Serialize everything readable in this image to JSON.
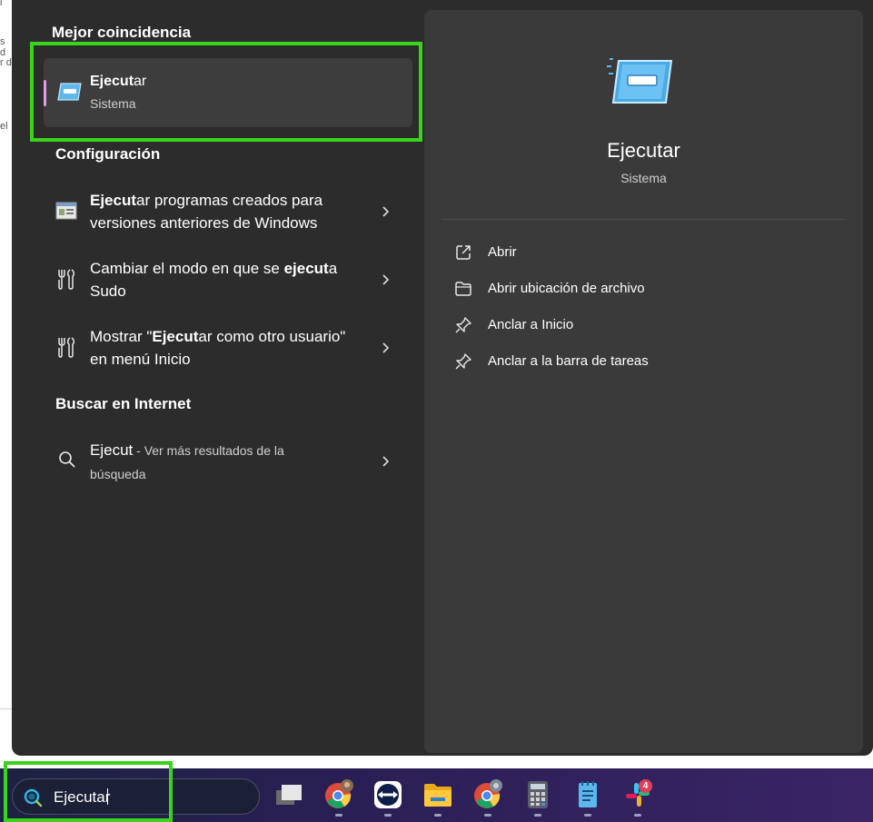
{
  "background": {
    "fragments": [
      "l",
      "s d",
      "r d",
      "el"
    ]
  },
  "search_panel": {
    "best_match": {
      "heading": "Mejor coincidencia",
      "title_bold": "Ejecut",
      "title_rest": "ar",
      "subtitle": "Sistema",
      "icon": "run-dialog-icon"
    },
    "settings": {
      "heading": "Configuración",
      "items": [
        {
          "icon": "compatibility-settings-icon",
          "pre": "",
          "bold": "Ejecut",
          "post": "ar programas creados para versiones anteriores de Windows"
        },
        {
          "icon": "developer-settings-icon",
          "pre": "Cambiar el modo en que se ",
          "bold": "ejecut",
          "post": "a Sudo"
        },
        {
          "icon": "developer-settings-icon",
          "pre": "Mostrar \"",
          "bold": "Ejecut",
          "post": "ar como otro usuario\" en menú Inicio"
        }
      ]
    },
    "web": {
      "heading": "Buscar en Internet",
      "query": "Ejecut",
      "suffix": " - Ver más resultados de la búsqueda",
      "icon": "search-icon"
    }
  },
  "details_pane": {
    "icon": "run-dialog-icon",
    "title": "Ejecutar",
    "subtitle": "Sistema",
    "actions": [
      {
        "label": "Abrir",
        "icon": "open-external-icon"
      },
      {
        "label": "Abrir ubicación de archivo",
        "icon": "folder-icon"
      },
      {
        "label": "Anclar a Inicio",
        "icon": "pin-icon"
      },
      {
        "label": "Anclar a la barra de tareas",
        "icon": "pin-icon"
      }
    ]
  },
  "taskbar": {
    "search_value": "Ejecutar",
    "apps": [
      {
        "name": "task-view-icon"
      },
      {
        "name": "chrome-icon"
      },
      {
        "name": "teamviewer-icon"
      },
      {
        "name": "file-explorer-icon"
      },
      {
        "name": "chrome-profile-icon"
      },
      {
        "name": "calculator-icon"
      },
      {
        "name": "notepad-icon"
      },
      {
        "name": "slack-icon",
        "badge": "4"
      }
    ]
  },
  "colors": {
    "highlight": "#3ad41c",
    "accent": "#e59ae4",
    "panel": "#2c2c2c",
    "details": "#3a3a3a"
  }
}
